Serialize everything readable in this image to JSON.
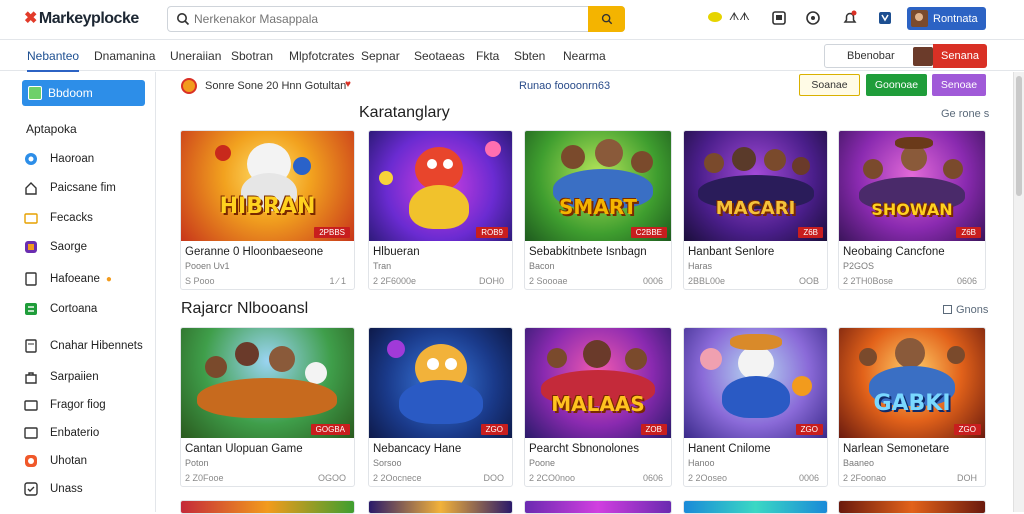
{
  "header": {
    "logo": "Markeyplocke",
    "search_placeholder": "Nerkenakor Masappala",
    "coin_label": "ᗑᗑ",
    "user_label": "Rontnata"
  },
  "nav": {
    "items": [
      "Nebanteo",
      "Dnamanina",
      "Uneraiian",
      "Sbotran",
      "Mlpfotcrates",
      "Sepnar",
      "Seotaeas",
      "Fkta",
      "Sbten",
      "Nearma"
    ],
    "right_label": "Bbenobar",
    "right_button": "Senana"
  },
  "sidebar": {
    "active": "Bbdoom",
    "heading": "Aptapoka",
    "items": [
      "Haoroan",
      "Paicsane fim",
      "Fecacks",
      "Saorge",
      "Hafoeane",
      "Cortoana",
      "Cnahar Hibennets",
      "Sarpaiien",
      "Fragor fiog",
      "Enbaterio",
      "Uhotan",
      "Unass"
    ]
  },
  "filters": {
    "text": "Sonre Sone 20  Hnn Gotultan",
    "center_link": "Runao foooonrn63",
    "pills": [
      "Soanae",
      "Goonoae",
      "Senoae"
    ]
  },
  "sections": [
    {
      "title": "Karatanglary",
      "see_all": "Ge rone s",
      "cards": [
        {
          "title": "Geranne 0 Hloonbaeseone",
          "sub": "Pooen Uv1",
          "meta": "S  Pooo",
          "price": "1 ∕ 1",
          "tag": "2PBBS",
          "art": "HIBRAN"
        },
        {
          "title": "Hlbueran",
          "sub": "Tran",
          "meta": "2 2F6000e",
          "price": "DOH0",
          "tag": "ROB9",
          "art": ""
        },
        {
          "title": "Sebabkitnbete Isnbagn",
          "sub": "Bacon",
          "meta": "2 Soooae",
          "price": "0006",
          "tag": "C2BBE",
          "art": "SMART"
        },
        {
          "title": "Hanbant Senlore",
          "sub": "Haras",
          "meta": "2BBL00e",
          "price": "OOB",
          "tag": "Z6B",
          "art": "MACARI"
        },
        {
          "title": "Neobaing Cancfone",
          "sub": "P2GOS",
          "meta": "2 2TH0Bose",
          "price": "0606",
          "tag": "Z6B",
          "art": "SHOWAN"
        }
      ]
    },
    {
      "title": "Rajarcr Nlbooansl",
      "see_all": "Gnons",
      "cards": [
        {
          "title": "Cantan Ulopuan Game",
          "sub": "Poton",
          "meta": "2 Z0Fooe",
          "price": "OGOO",
          "tag": "GOGBA",
          "art": ""
        },
        {
          "title": "Nebancacy Hane",
          "sub": "Sorsoo",
          "meta": "2 2Oocnece",
          "price": "DOO",
          "tag": "ZGO",
          "art": ""
        },
        {
          "title": "Pearcht Sbnonolones",
          "sub": "Poone",
          "meta": "2 2CO0noo",
          "price": "0606",
          "tag": "ZOB",
          "art": "MALAAS"
        },
        {
          "title": "Hanent Cnilome",
          "sub": "Hanoo",
          "meta": "2 2Ooseo",
          "price": "0006",
          "tag": "ZGO",
          "art": ""
        },
        {
          "title": "Narlean Semonetare",
          "sub": "Baaneo",
          "meta": "2 2Foonao",
          "price": "DOH",
          "tag": "ZGO",
          "art": "GABKI"
        }
      ]
    }
  ],
  "colors": {
    "accent": "#2c63c4",
    "sidebar_active": "#2d8ee8",
    "search_button": "#f4b400",
    "tag": "#c81e1e"
  }
}
